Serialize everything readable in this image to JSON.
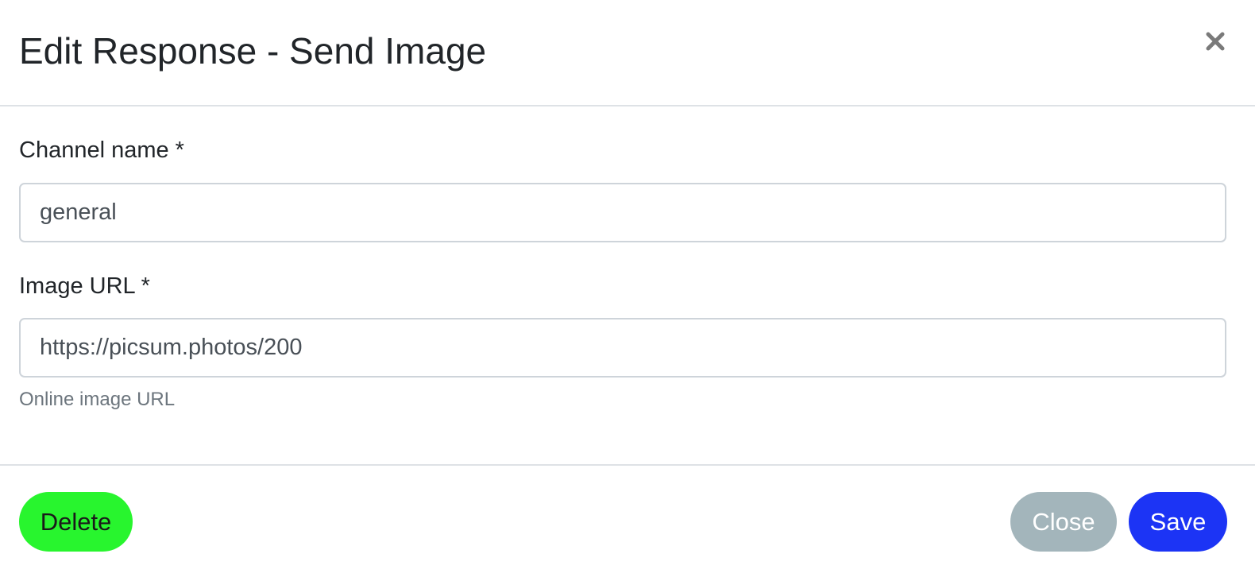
{
  "modal": {
    "title": "Edit Response - Send Image",
    "close_icon": "times-icon"
  },
  "form": {
    "channel": {
      "label": "Channel name *",
      "value": "general"
    },
    "image_url": {
      "label": "Image URL *",
      "value": "https://picsum.photos/200",
      "help": "Online image URL"
    }
  },
  "footer": {
    "delete_label": "Delete",
    "close_label": "Close",
    "save_label": "Save"
  },
  "colors": {
    "delete": "#28f52e",
    "close": "#a3b5bb",
    "save": "#1c34f5",
    "close_icon": "#7a7a7a",
    "divider": "#dee2e6"
  }
}
